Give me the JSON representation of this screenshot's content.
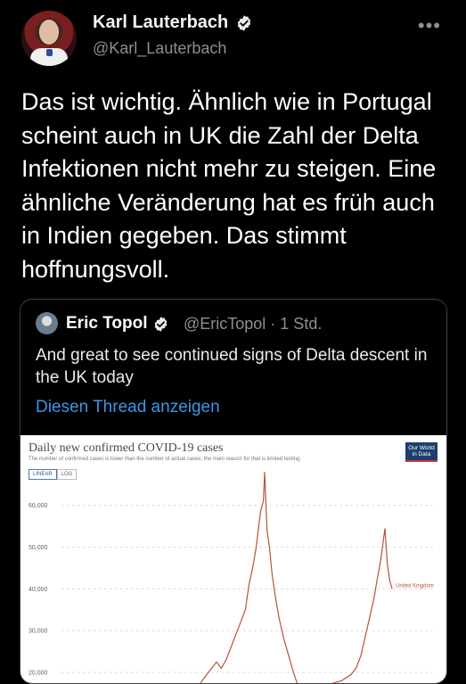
{
  "author": {
    "name": "Karl Lauterbach",
    "handle": "@Karl_Lauterbach"
  },
  "tweet": {
    "text": "Das ist wichtig. Ähnlich wie in Portugal scheint auch in UK die Zahl der Delta Infektionen nicht mehr zu steigen. Eine ähnliche Veränderung hat es früh auch in Indien gegeben. Das stimmt hoffnungsvoll."
  },
  "quoted": {
    "name": "Eric Topol",
    "meta": "@EricTopol · 1 Std.",
    "text": "And great to see continued signs of Delta descent in the UK today",
    "thread_link": "Diesen Thread anzeigen"
  },
  "chart_data": {
    "type": "line",
    "title": "Daily new confirmed COVID-19 cases",
    "subtitle": "The number of confirmed cases is lower than the number of actual cases; the main reason for that is limited testing.",
    "logo": "Our World in Data",
    "toggles": [
      "LINEAR",
      "LOG"
    ],
    "active_toggle": "LINEAR",
    "y_ticks": [
      "60,000",
      "50,000",
      "40,000",
      "30,000",
      "20,000"
    ],
    "ylim": [
      17000,
      64000
    ],
    "series": [
      {
        "name": "United Kingdom",
        "color": "#b5533c",
        "points": [
          [
            0.0,
            10000
          ],
          [
            0.03,
            11000
          ],
          [
            0.06,
            12500
          ],
          [
            0.09,
            14000
          ],
          [
            0.12,
            16000
          ],
          [
            0.14,
            18000
          ],
          [
            0.16,
            19500
          ],
          [
            0.18,
            21000
          ],
          [
            0.2,
            22500
          ],
          [
            0.22,
            21000
          ],
          [
            0.24,
            23000
          ],
          [
            0.26,
            26000
          ],
          [
            0.28,
            29000
          ],
          [
            0.3,
            32000
          ],
          [
            0.32,
            35000
          ],
          [
            0.335,
            41000
          ],
          [
            0.35,
            45000
          ],
          [
            0.365,
            50000
          ],
          [
            0.375,
            55000
          ],
          [
            0.385,
            59000
          ],
          [
            0.395,
            61000
          ],
          [
            0.4,
            68000
          ],
          [
            0.41,
            54000
          ],
          [
            0.42,
            50000
          ],
          [
            0.43,
            44000
          ],
          [
            0.445,
            38000
          ],
          [
            0.46,
            33000
          ],
          [
            0.48,
            28000
          ],
          [
            0.5,
            24000
          ],
          [
            0.52,
            20000
          ],
          [
            0.54,
            16500
          ],
          [
            0.6,
            16000
          ],
          [
            0.66,
            17000
          ],
          [
            0.72,
            18000
          ],
          [
            0.76,
            19500
          ],
          [
            0.78,
            21000
          ],
          [
            0.8,
            24000
          ],
          [
            0.82,
            29000
          ],
          [
            0.84,
            34000
          ],
          [
            0.855,
            38000
          ],
          [
            0.87,
            43000
          ],
          [
            0.88,
            46000
          ],
          [
            0.89,
            50000
          ],
          [
            0.9,
            54500
          ],
          [
            0.91,
            46000
          ],
          [
            0.92,
            42000
          ],
          [
            0.93,
            40000
          ]
        ]
      }
    ]
  }
}
